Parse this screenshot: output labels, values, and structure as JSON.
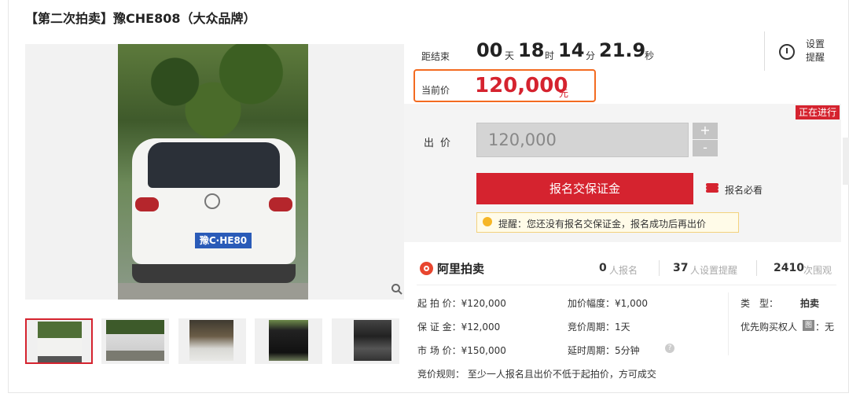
{
  "title": "【第二次拍卖】豫CHE808（大众品牌）",
  "countdown": {
    "label": "距结束",
    "days": "00",
    "days_unit": "天",
    "hours": "18",
    "hours_unit": "时",
    "minutes": "14",
    "minutes_unit": "分",
    "seconds": "21.9",
    "seconds_unit": "秒"
  },
  "reminder": {
    "line1": "设置",
    "line2": "提醒",
    "icon": "alarm-clock-icon"
  },
  "current_price": {
    "label": "当前价",
    "value": "120,000",
    "unit": "元"
  },
  "status_tag": "正在进行",
  "bid": {
    "label": "出价",
    "input_value": "120,000",
    "plus": "+",
    "minus": "-"
  },
  "apply_button": "报名交保证金",
  "must_read": "报名必看",
  "tip": "提醒：您还没有报名交保证金，报名成功后再出价",
  "platform": "阿里拍卖",
  "stats": [
    {
      "value": "0",
      "unit": "人报名"
    },
    {
      "value": "37",
      "unit": "人设置提醒"
    },
    {
      "value": "2410",
      "unit": "次围观"
    }
  ],
  "info": {
    "start_price": "起 拍 价：¥120,000",
    "deposit": "保 证 金：¥12,000",
    "market_price": "市 场 价：¥150,000",
    "increment": "加价幅度：¥1,000",
    "bid_period": "竞价周期：1天",
    "delay_period": "延时周期：5分钟",
    "type_label": "类　型：",
    "type_value": "拍卖",
    "priority_label": "优先购买权人",
    "priority_badge": "图",
    "priority_value": "：无",
    "rule": "竞价规则：  至少一人报名且出价不低于起拍价，方可成交"
  },
  "plate_text": "豫C·HE80"
}
